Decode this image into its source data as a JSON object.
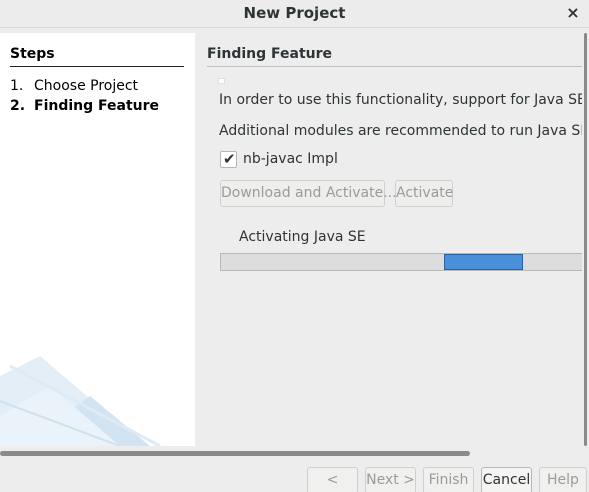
{
  "window": {
    "title": "New Project",
    "close_glyph": "×"
  },
  "steps": {
    "heading": "Steps",
    "items": [
      {
        "num": "1.",
        "label": "Choose Project",
        "current": false
      },
      {
        "num": "2.",
        "label": "Finding Feature",
        "current": true
      }
    ]
  },
  "panel": {
    "title": "Finding Feature",
    "message1": "In order to use this functionality, support for Java SE must",
    "message2": "Additional modules are recommended to run Java SE supp",
    "module": {
      "label": "nb-javac Impl",
      "checked": true
    },
    "download_button": "Download and Activate...",
    "activate_button": "Activate",
    "progress_label": "Activating Java SE"
  },
  "footer": {
    "back": "< Back",
    "next": "Next >",
    "finish": "Finish",
    "cancel": "Cancel",
    "help": "Help"
  },
  "colors": {
    "progress": "#4a90d9",
    "wizard_panel": "#ffffff",
    "background": "#ededed"
  },
  "icons": {
    "close": "close-icon",
    "check": "checkmark-icon"
  }
}
